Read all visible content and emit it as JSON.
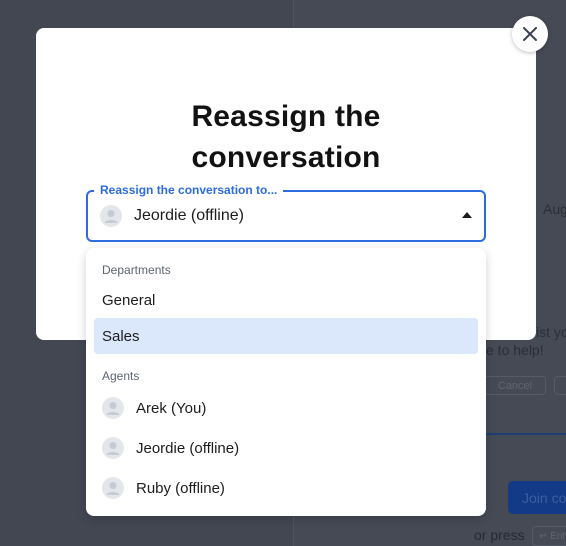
{
  "modal": {
    "title_line1": "Reassign the",
    "title_line2": "conversation",
    "close_icon": "close-icon"
  },
  "select": {
    "legend": "Reassign the conversation to...",
    "value": "Jeordie (offline)",
    "avatar_icon": "user-avatar-icon",
    "caret_icon": "caret-up-icon"
  },
  "dropdown": {
    "departments_label": "Departments",
    "departments": [
      {
        "label": "General",
        "selected": false
      },
      {
        "label": "Sales",
        "selected": true
      }
    ],
    "agents_label": "Agents",
    "agents": [
      {
        "label": "Arek (You)"
      },
      {
        "label": "Jeordie (offline)"
      },
      {
        "label": "Ruby (offline)"
      }
    ]
  },
  "background": {
    "date_fragment": "Aug",
    "message_line1_fragment": "ist yo",
    "message_line2_fragment": "e to help!",
    "cancel_label": "Cancel",
    "join_label": "Join co",
    "or_press": "or press",
    "enter_label": "↵ Ent"
  },
  "colors": {
    "accent": "#2d6cdf",
    "selected_bg": "#dbe7fb",
    "overlay": "#3a3f4a"
  }
}
